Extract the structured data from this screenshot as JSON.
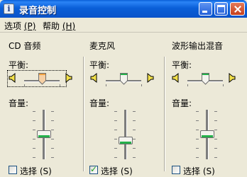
{
  "window": {
    "title": "录音控制"
  },
  "menu": [
    {
      "label": "选项",
      "accel": "(P)"
    },
    {
      "label": "帮助",
      "accel": "(H)"
    }
  ],
  "channels": [
    {
      "name": "CD 音频",
      "balance_label": "平衡:",
      "volume_label": "音量:",
      "select_label": "选择 (S)",
      "selected": false,
      "balance": 0.5,
      "volume": 0.45
    },
    {
      "name": "麦克风",
      "balance_label": "平衡:",
      "volume_label": "音量:",
      "select_label": "选择 (S)",
      "selected": true,
      "balance": 0.5,
      "volume": 0.25
    },
    {
      "name": "波形输出混音",
      "balance_label": "平衡:",
      "volume_label": "音量:",
      "select_label": "选择 (S)",
      "selected": false,
      "balance": 0.5,
      "volume": 0.45
    }
  ],
  "icons": {
    "speaker_left": "speaker-left-icon",
    "speaker_right": "speaker-right-icon"
  },
  "colors": {
    "titlebar": "#0a5fd8",
    "thumb_accent": "#24b04a",
    "window_bg": "#ece9d8"
  }
}
